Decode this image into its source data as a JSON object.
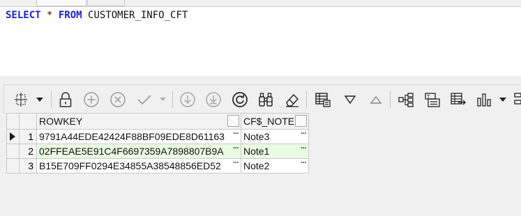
{
  "editor": {
    "sql": {
      "kw1": "SELECT",
      "star": " * ",
      "kw2": "FROM",
      "table": " CUSTOMER_INFO_CFT"
    }
  },
  "toolbar": {
    "buttons": [
      {
        "name": "select-rows-icon",
        "enabled": true
      },
      {
        "name": "dropdown-icon",
        "enabled": true
      },
      {
        "name": "lock-icon",
        "enabled": true
      },
      {
        "name": "add-record-icon",
        "enabled": false
      },
      {
        "name": "delete-record-icon",
        "enabled": false
      },
      {
        "name": "post-edit-icon",
        "enabled": false
      },
      {
        "name": "previous-page-icon",
        "enabled": false
      },
      {
        "name": "next-page-icon",
        "enabled": false
      },
      {
        "name": "refresh-icon",
        "enabled": true
      },
      {
        "name": "find-icon",
        "enabled": true
      },
      {
        "name": "clear-icon",
        "enabled": true
      },
      {
        "name": "grid-view-icon",
        "enabled": true
      },
      {
        "name": "filter-icon",
        "enabled": true
      },
      {
        "name": "sort-up-icon",
        "enabled": true
      },
      {
        "name": "tree-view-icon",
        "enabled": true
      },
      {
        "name": "single-record-icon",
        "enabled": true
      },
      {
        "name": "export-icon",
        "enabled": true
      },
      {
        "name": "chart-icon",
        "enabled": true
      }
    ]
  },
  "grid": {
    "columns": [
      "ROWKEY",
      "CF$_NOTE"
    ],
    "rows": [
      {
        "num": "1",
        "rowkey": "9791A44EDE42424F88BF09EDE8D61163",
        "note": "Note3"
      },
      {
        "num": "2",
        "rowkey": "02FFEAE5E91C4F6697359A7898807B9A",
        "note": "Note1"
      },
      {
        "num": "3",
        "rowkey": "B15E709FF0294E34855A38548856ED52",
        "note": "Note2"
      }
    ],
    "ellipsis": "···"
  },
  "colors": {
    "keyword": "#1c1ce6",
    "selected_row": "#e9fbe3"
  }
}
